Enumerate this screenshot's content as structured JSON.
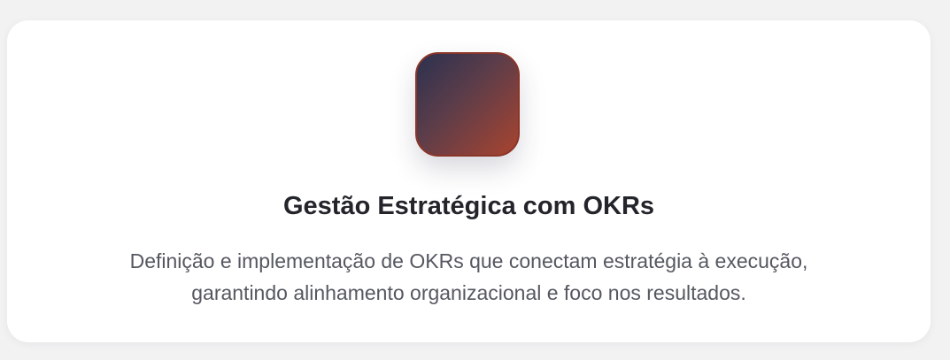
{
  "service": {
    "title": "Gestão Estratégica com OKRs",
    "description_line1": "Definição e implementação de OKRs que conectam estratégia à execução,",
    "description_line2": "garantindo alinhamento organizacional e foco nos resultados.",
    "icon": "gradient-tile-icon",
    "gradient_colors": [
      "#2b3150",
      "#5e3d49",
      "#a9442f"
    ]
  }
}
